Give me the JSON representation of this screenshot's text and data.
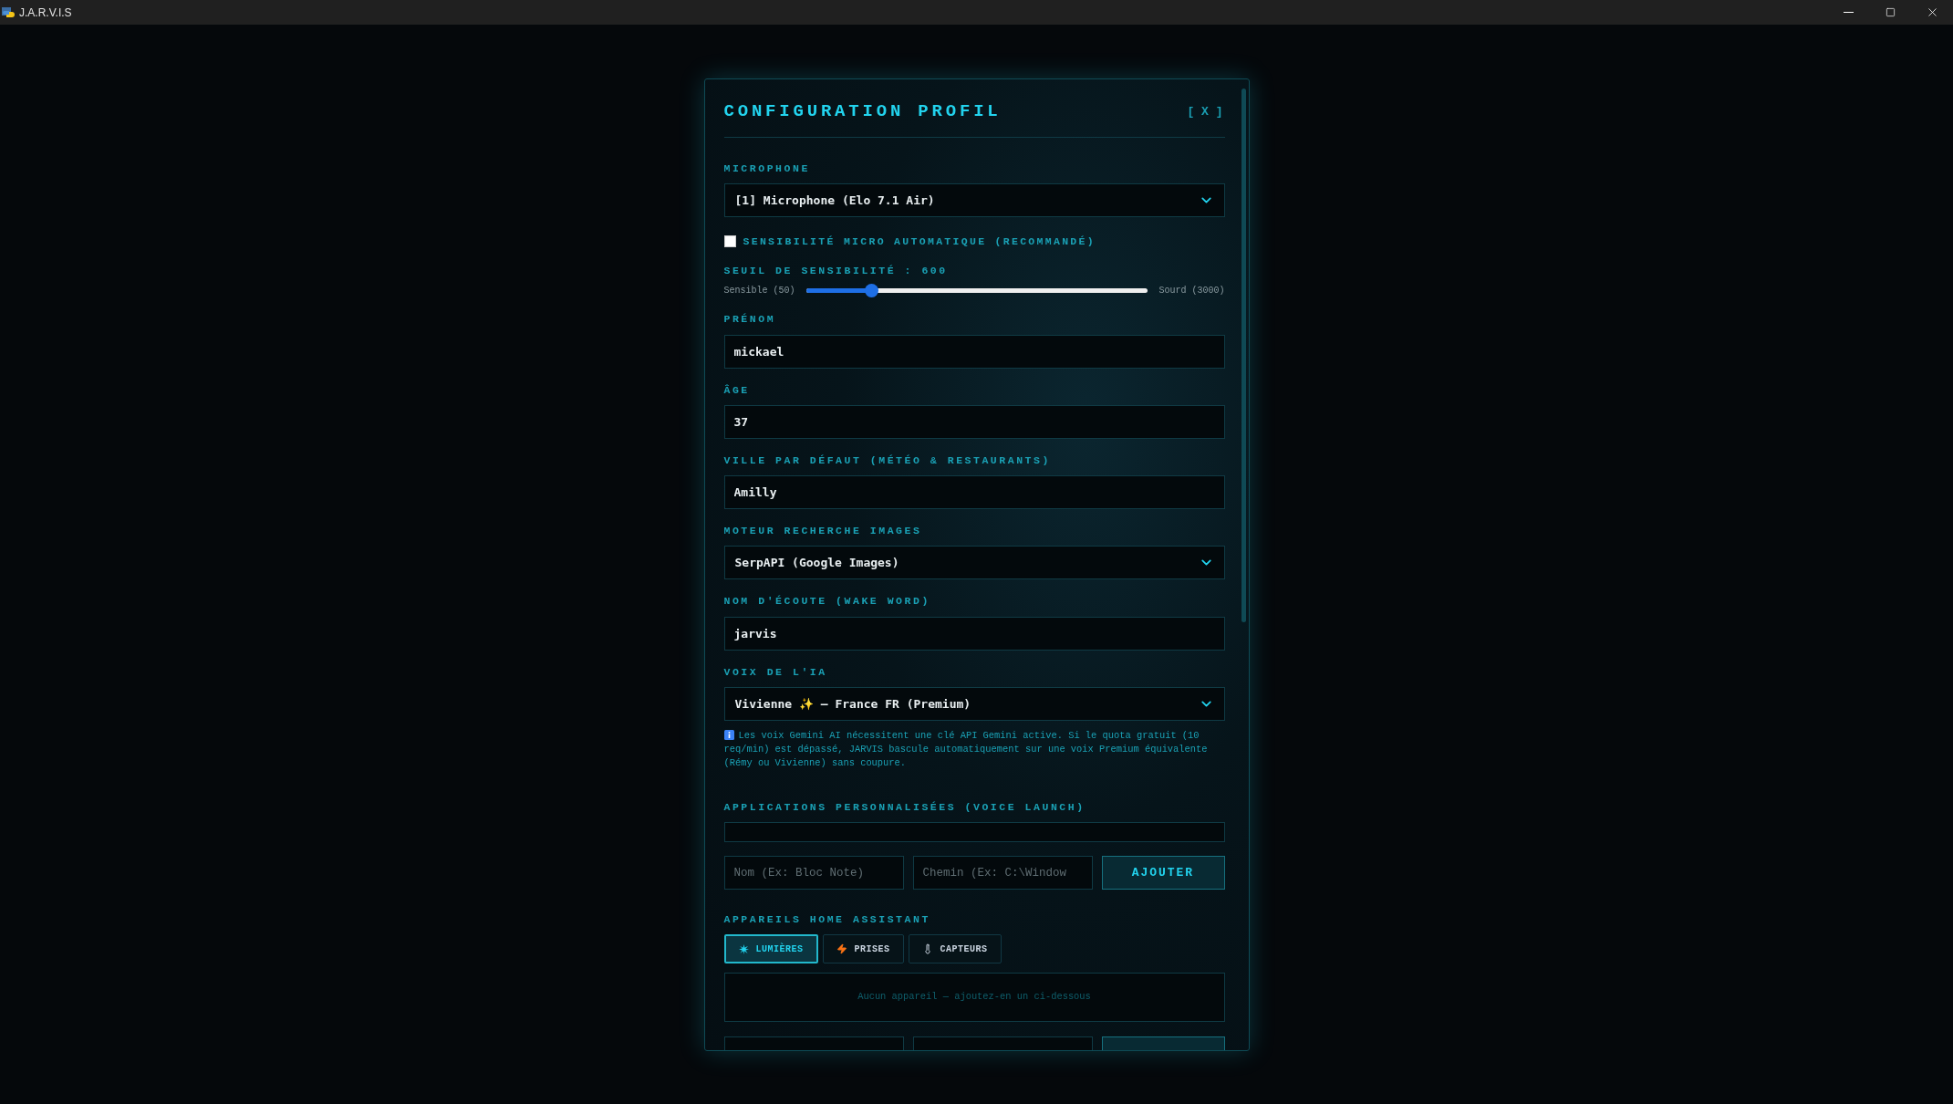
{
  "window": {
    "title": "J.A.R.V.I.S"
  },
  "dialog": {
    "title": "CONFIGURATION PROFIL",
    "close": "[ X ]"
  },
  "microphone": {
    "label": "MICROPHONE",
    "value": "[1] Microphone (Elo 7.1 Air)"
  },
  "auto_sensitivity": {
    "label": "SENSIBILITÉ MICRO AUTOMATIQUE (RECOMMANDÉ)",
    "checked": false
  },
  "threshold": {
    "label": "SEUIL DE SENSIBILITÉ : 600",
    "min_label": "Sensible (50)",
    "max_label": "Sourd (3000)",
    "level": 0.19
  },
  "fields": [
    {
      "kind": "text",
      "label": "PRÉNOM",
      "value": "mickael"
    },
    {
      "kind": "text",
      "label": "ÂGE",
      "value": "37"
    },
    {
      "kind": "text",
      "label": "VILLE PAR DÉFAUT (MÉTÉO & RESTAURANTS)",
      "value": "Amilly"
    },
    {
      "kind": "select",
      "label": "MOTEUR RECHERCHE IMAGES",
      "value": "SerpAPI (Google Images)"
    },
    {
      "kind": "text",
      "label": "NOM D'ÉCOUTE (WAKE WORD)",
      "value": "jarvis"
    },
    {
      "kind": "select",
      "label": "VOIX DE L'IA",
      "value": "Vivienne ✨ — France FR (Premium)"
    }
  ],
  "voice_note": "Les voix Gemini AI nécessitent une clé API Gemini active. Si le quota gratuit (10 req/min) est dépassé, JARVIS bascule automatiquement sur une voix Premium équivalente (Rémy ou Vivienne) sans coupure.",
  "apps": {
    "label": "APPLICATIONS PERSONNALISÉES (VOICE LAUNCH)",
    "name_placeholder": "Nom (Ex: Bloc Note)",
    "path_placeholder": "Chemin (Ex: C:\\Window",
    "button": "AJOUTER"
  },
  "home_assistant": {
    "label": "APPAREILS HOME ASSISTANT",
    "tabs": [
      {
        "kind": "lights",
        "label": "LUMIÈRES",
        "selected": true
      },
      {
        "kind": "plugs",
        "label": "PRISES",
        "selected": false
      },
      {
        "kind": "sensors",
        "label": "CAPTEURS",
        "selected": false
      }
    ],
    "empty": "Aucun appareil — ajoutez-en un ci-dessous"
  }
}
